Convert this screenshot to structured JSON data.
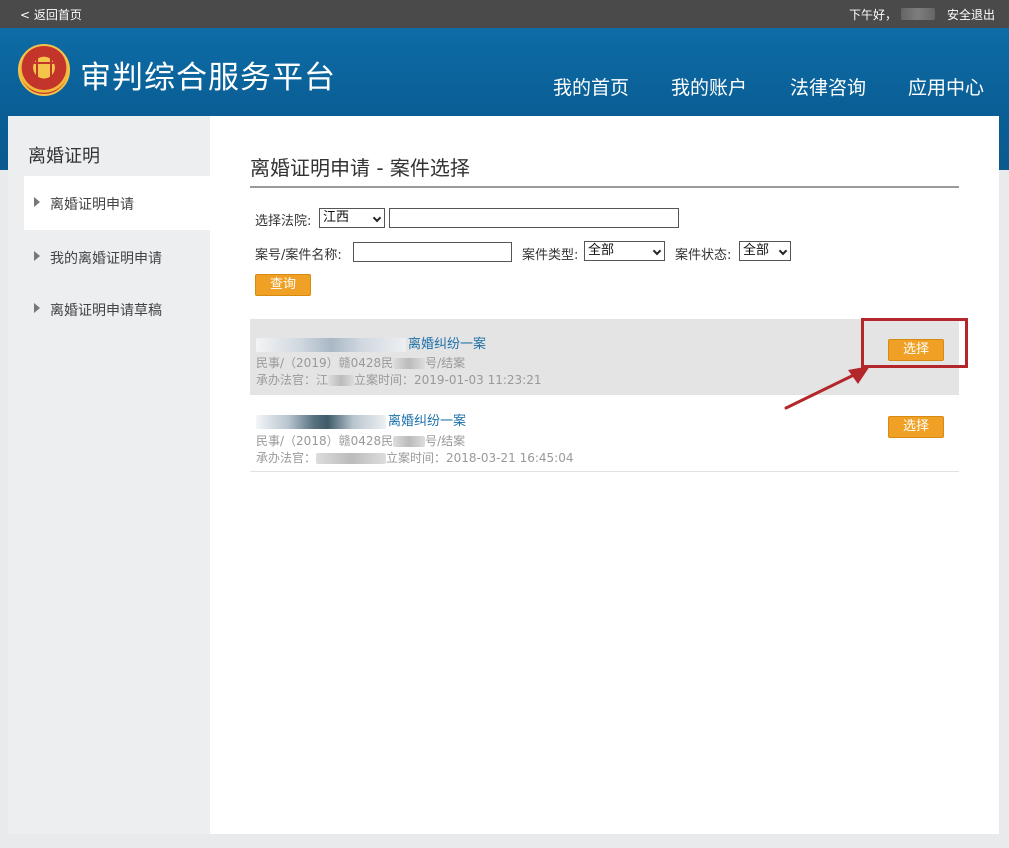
{
  "topbar": {
    "back_label": "< 返回首页",
    "greeting": "下午好，",
    "logout_label": "安全退出"
  },
  "header": {
    "title": "审判综合服务平台",
    "nav": [
      {
        "label": "我的首页"
      },
      {
        "label": "我的账户"
      },
      {
        "label": "法律咨询"
      },
      {
        "label": "应用中心"
      }
    ]
  },
  "sidebar": {
    "title": "离婚证明",
    "items": [
      {
        "label": "离婚证明申请",
        "active": true
      },
      {
        "label": "我的离婚证明申请",
        "active": false
      },
      {
        "label": "离婚证明申请草稿",
        "active": false
      }
    ]
  },
  "main": {
    "title": "离婚证明申请 - 案件选择",
    "filters": {
      "court_label": "选择法院:",
      "court_value": "江西",
      "court_input_value": "",
      "case_label": "案号/案件名称:",
      "case_input_value": "",
      "type_label": "案件类型:",
      "type_value": "全部",
      "status_label": "案件状态:",
      "status_value": "全部",
      "query_label": "查询"
    },
    "cases": [
      {
        "title_suffix": "离婚纠纷一案",
        "line1_prefix": "民事/（2019）赣0428民",
        "line1_suffix": "号/结案",
        "line2_prefix": "承办法官：江",
        "line2_suffix": "立案时间：2019-01-03 11:23:21",
        "select_label": "选择",
        "highlighted": true
      },
      {
        "title_suffix": "离婚纠纷一案",
        "line1_prefix": "民事/（2018）赣0428民",
        "line1_suffix": "号/结案",
        "line2_prefix": "承办法官：",
        "line2_suffix": "立案时间：2018-03-21 16:45:04",
        "select_label": "选择",
        "highlighted": false
      }
    ]
  },
  "colors": {
    "header_blue": "#0a5f96",
    "accent_orange": "#f0a125",
    "annotation_red": "#b3262a",
    "link_blue": "#1b6fa8"
  },
  "icons": {
    "emblem": "court-emblem-icon",
    "sidebar_marker": "triangle-right-icon",
    "dropdown": "chevron-down-icon",
    "annotation": "arrow-annotation-icon"
  }
}
